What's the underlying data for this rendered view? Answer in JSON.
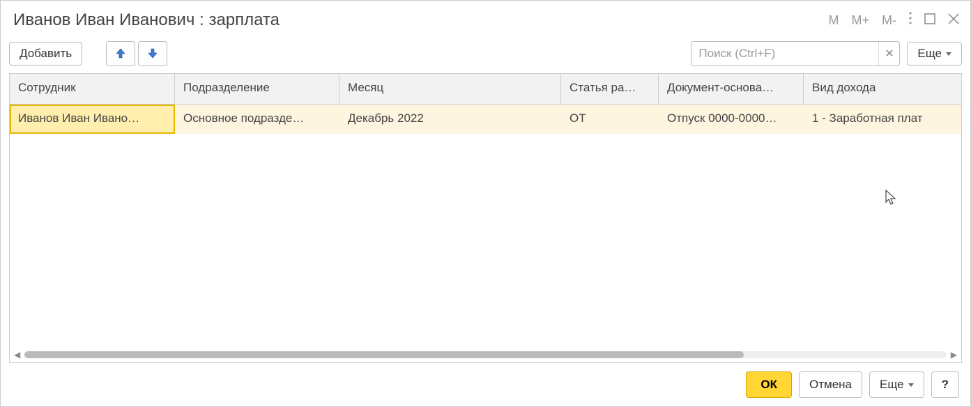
{
  "window": {
    "title": "Иванов Иван Иванович : зарплата"
  },
  "titlebar": {
    "mem_m": "M",
    "mem_mplus": "M+",
    "mem_mminus": "M-"
  },
  "toolbar": {
    "add_label": "Добавить",
    "search_placeholder": "Поиск (Ctrl+F)",
    "more_label": "Еще"
  },
  "table": {
    "columns": [
      "Сотрудник",
      "Подразделение",
      "Месяц",
      "Статья ра…",
      "Документ-основа…",
      "Вид дохода"
    ],
    "rows": [
      {
        "cells": [
          "Иванов Иван Ивано…",
          "Основное подразде…",
          "Декабрь 2022",
          "ОТ",
          "Отпуск 0000-0000…",
          "1 - Заработная плат"
        ]
      }
    ]
  },
  "footer": {
    "ok_label": "ОК",
    "cancel_label": "Отмена",
    "more_label": "Еще",
    "help_label": "?"
  }
}
